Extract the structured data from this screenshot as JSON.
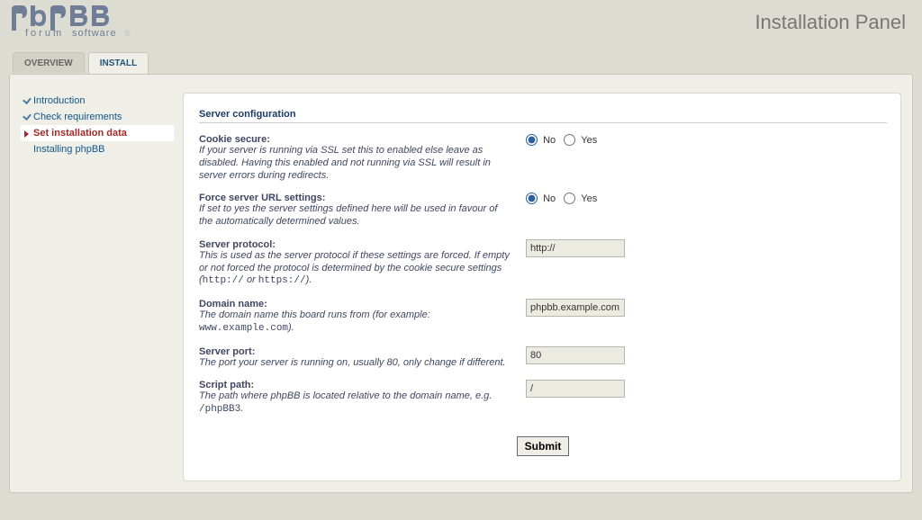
{
  "header": {
    "title": "Installation Panel"
  },
  "tabs": [
    {
      "label": "OVERVIEW",
      "active": false
    },
    {
      "label": "INSTALL",
      "active": true
    }
  ],
  "sidebar": [
    {
      "label": "Introduction",
      "state": "done"
    },
    {
      "label": "Check requirements",
      "state": "done"
    },
    {
      "label": "Set installation data",
      "state": "current"
    },
    {
      "label": "Installing phpBB",
      "state": "pending"
    }
  ],
  "form": {
    "legend": "Server configuration",
    "options": {
      "no": "No",
      "yes": "Yes"
    },
    "cookie_secure": {
      "label": "Cookie secure:",
      "desc": "If your server is running via SSL set this to enabled else leave as disabled. Having this enabled and not running via SSL will result in server errors during redirects.",
      "value": "no"
    },
    "force_url": {
      "label": "Force server URL settings:",
      "desc": "If set to yes the server settings defined here will be used in favour of the automatically determined values.",
      "value": "no"
    },
    "protocol": {
      "label": "Server protocol:",
      "desc_pre": "This is used as the server protocol if these settings are forced. If empty or not forced the protocol is determined by the cookie secure settings (",
      "code1": "http://",
      "mid": " or ",
      "code2": "https://",
      "desc_post": ").",
      "value": "http://"
    },
    "domain": {
      "label": "Domain name:",
      "desc_pre": "The domain name this board runs from (for example: ",
      "code": "www.example.com",
      "desc_post": ").",
      "value": "phpbb.example.com"
    },
    "port": {
      "label": "Server port:",
      "desc": "The port your server is running on, usually 80, only change if different.",
      "value": "80"
    },
    "script_path": {
      "label": "Script path:",
      "desc_pre": "The path where phpBB is located relative to the domain name, e.g. ",
      "code": "/phpBB3",
      "desc_post": ".",
      "value": "/"
    },
    "submit": "Submit"
  }
}
